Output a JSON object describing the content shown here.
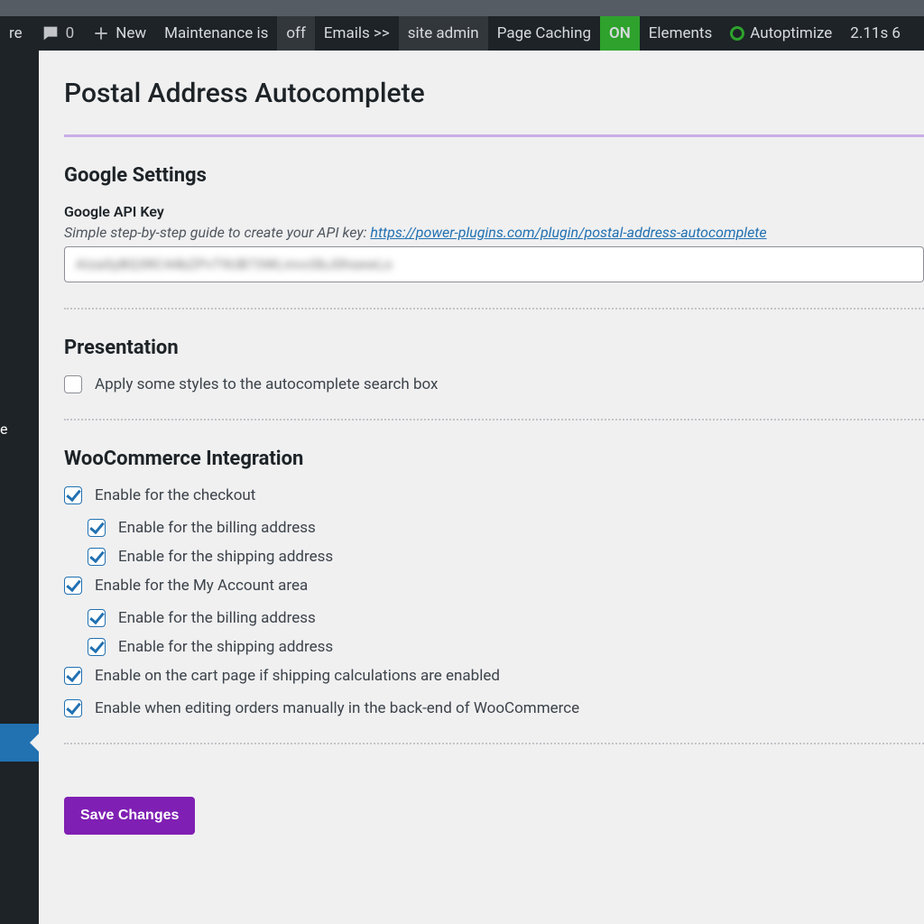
{
  "adminbar": {
    "re_fragment": "re",
    "comments_count": "0",
    "new_label": "New",
    "maintenance_label": "Maintenance is",
    "maintenance_state": "off",
    "emails_label": "Emails >>",
    "site_admin_label": "site admin",
    "page_caching_label": "Page Caching",
    "page_caching_state": "ON",
    "elements_label": "Elements",
    "autoptimize_label": "Autoptimize",
    "timing": "2.11s  6"
  },
  "sidebar": {
    "partial_item": "e"
  },
  "page": {
    "title": "Postal Address Autocomplete",
    "save_button": "Save Changes"
  },
  "google": {
    "section_title": "Google Settings",
    "api_key_label": "Google API Key",
    "help_prefix": "Simple step-by-step guide to create your API key: ",
    "help_link_text": "https://power-plugins.com/plugin/postal-address-autocomplete",
    "api_key_value_obscured": "AIzaSyBQ3RC44bZPvT9UB73WLmvc0bJ0hsewLo"
  },
  "presentation": {
    "section_title": "Presentation",
    "apply_styles_label": "Apply some styles to the autocomplete search box",
    "apply_styles_checked": false
  },
  "woocommerce": {
    "section_title": "WooCommerce Integration",
    "items": [
      {
        "label": "Enable for the checkout",
        "checked": true,
        "indent": 0
      },
      {
        "label": "Enable for the billing address",
        "checked": true,
        "indent": 1
      },
      {
        "label": "Enable for the shipping address",
        "checked": true,
        "indent": 1
      },
      {
        "label": "Enable for the My Account area",
        "checked": true,
        "indent": 0
      },
      {
        "label": "Enable for the billing address",
        "checked": true,
        "indent": 1
      },
      {
        "label": "Enable for the shipping address",
        "checked": true,
        "indent": 1
      },
      {
        "label": "Enable on the cart page if shipping calculations are enabled",
        "checked": true,
        "indent": 0
      },
      {
        "label": "Enable when editing orders manually in the back-end of WooCommerce",
        "checked": true,
        "indent": 0
      }
    ]
  }
}
